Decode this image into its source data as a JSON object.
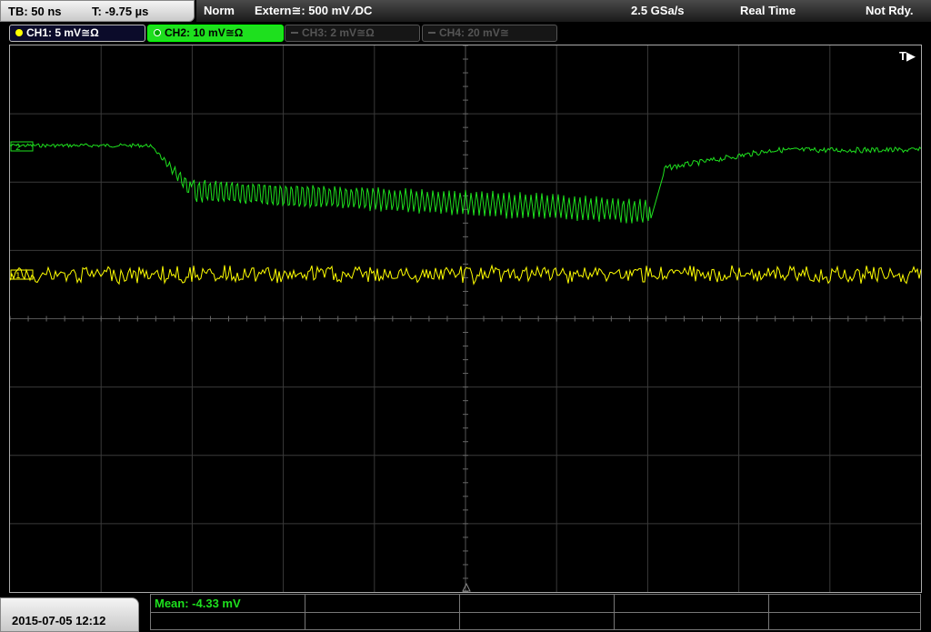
{
  "timebase": {
    "tb": "TB: 50 ns",
    "trigger_time": "T: -9.75 µs"
  },
  "status": {
    "mode": "Norm",
    "trigger": "Extern≅: 500 mV ⁄DC",
    "sample_rate": "2.5 GSa/s",
    "acq_mode": "Real Time",
    "state": "Not Rdy."
  },
  "channels": [
    {
      "label": "CH1: 5 mV≅Ω",
      "color": "#ffff00",
      "active": true
    },
    {
      "label": "CH2: 10 mV≅Ω",
      "color": "#1ee01e",
      "active": true,
      "selected": true
    },
    {
      "label": "CH3: 2 mV≅Ω",
      "color": "#555555",
      "active": false
    },
    {
      "label": "CH4: 20 mV≅",
      "color": "#555555",
      "active": false
    }
  ],
  "screen": {
    "trigger_marker": "T▶",
    "ch1_marker": "1",
    "ch2_marker": "2"
  },
  "footer": {
    "datetime": "2015-07-05 12:12",
    "measurement": "Mean: -4.33 mV"
  }
}
